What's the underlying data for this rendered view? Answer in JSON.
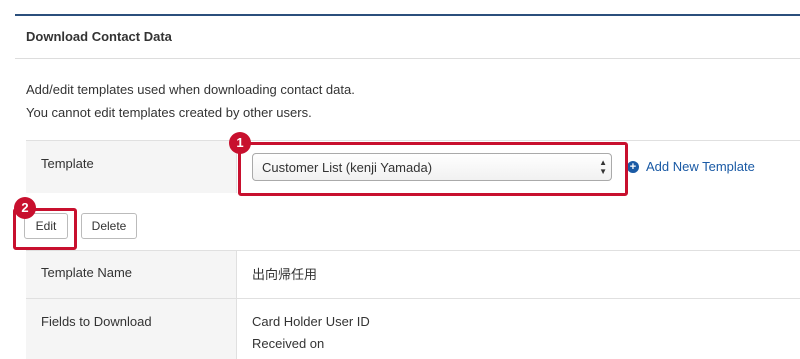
{
  "panel": {
    "title": "Download Contact Data"
  },
  "description": {
    "line1": "Add/edit templates used when downloading contact data.",
    "line2": "You cannot edit templates created by other users."
  },
  "template_row": {
    "label": "Template",
    "selected": "Customer List (kenji Yamada)",
    "add_new_label": "Add New Template"
  },
  "buttons": {
    "edit": "Edit",
    "delete": "Delete"
  },
  "annotations": {
    "badge1": "1",
    "badge2": "2"
  },
  "details": {
    "name_label": "Template Name",
    "name_value": "出向帰任用",
    "fields_label": "Fields to Download",
    "fields": [
      "Card Holder User ID",
      "Received on"
    ]
  },
  "icons": {
    "add": "plus-circle-icon",
    "select_arrows": "updown-arrows-icon"
  },
  "colors": {
    "accent": "#1a5aa5",
    "highlight": "#c8102e",
    "topbar": "#2b4f7c"
  }
}
